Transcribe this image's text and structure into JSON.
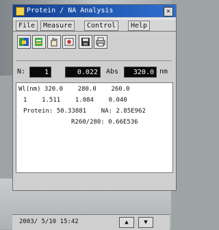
{
  "window": {
    "title": "Protein / NA Analysis",
    "close_glyph": "×"
  },
  "menu": [
    "File",
    "Measure",
    "Control",
    "Help"
  ],
  "toolbar": {
    "icons": [
      "measure-icon",
      "blank-icon",
      "hand-icon",
      "print-preview-icon",
      "save-icon",
      "printer-icon"
    ]
  },
  "fields": {
    "n_label": "N:",
    "n_value": "1",
    "abs_value": "0.022",
    "abs_label": "Abs",
    "wavelength_value": "320.0",
    "wavelength_unit": "nm"
  },
  "results": {
    "header": "Wl(nm) 320.0    280.0    260.0",
    "row1": "1    1.511    1.084    0.040",
    "protein_line": "Protein: 50.33881    NA: 2.85E962",
    "ratio_line": "R260/280: 0.66E536"
  },
  "status": {
    "datetime": "2003/ 5/10 15:42",
    "up_glyph": "▲",
    "down_glyph": "▼"
  },
  "colors": {
    "titlebar": "#1c4fa8",
    "lcd_background": "#0a0a0a",
    "lcd_text": "#ffffff",
    "window": "#cfcfcf"
  }
}
